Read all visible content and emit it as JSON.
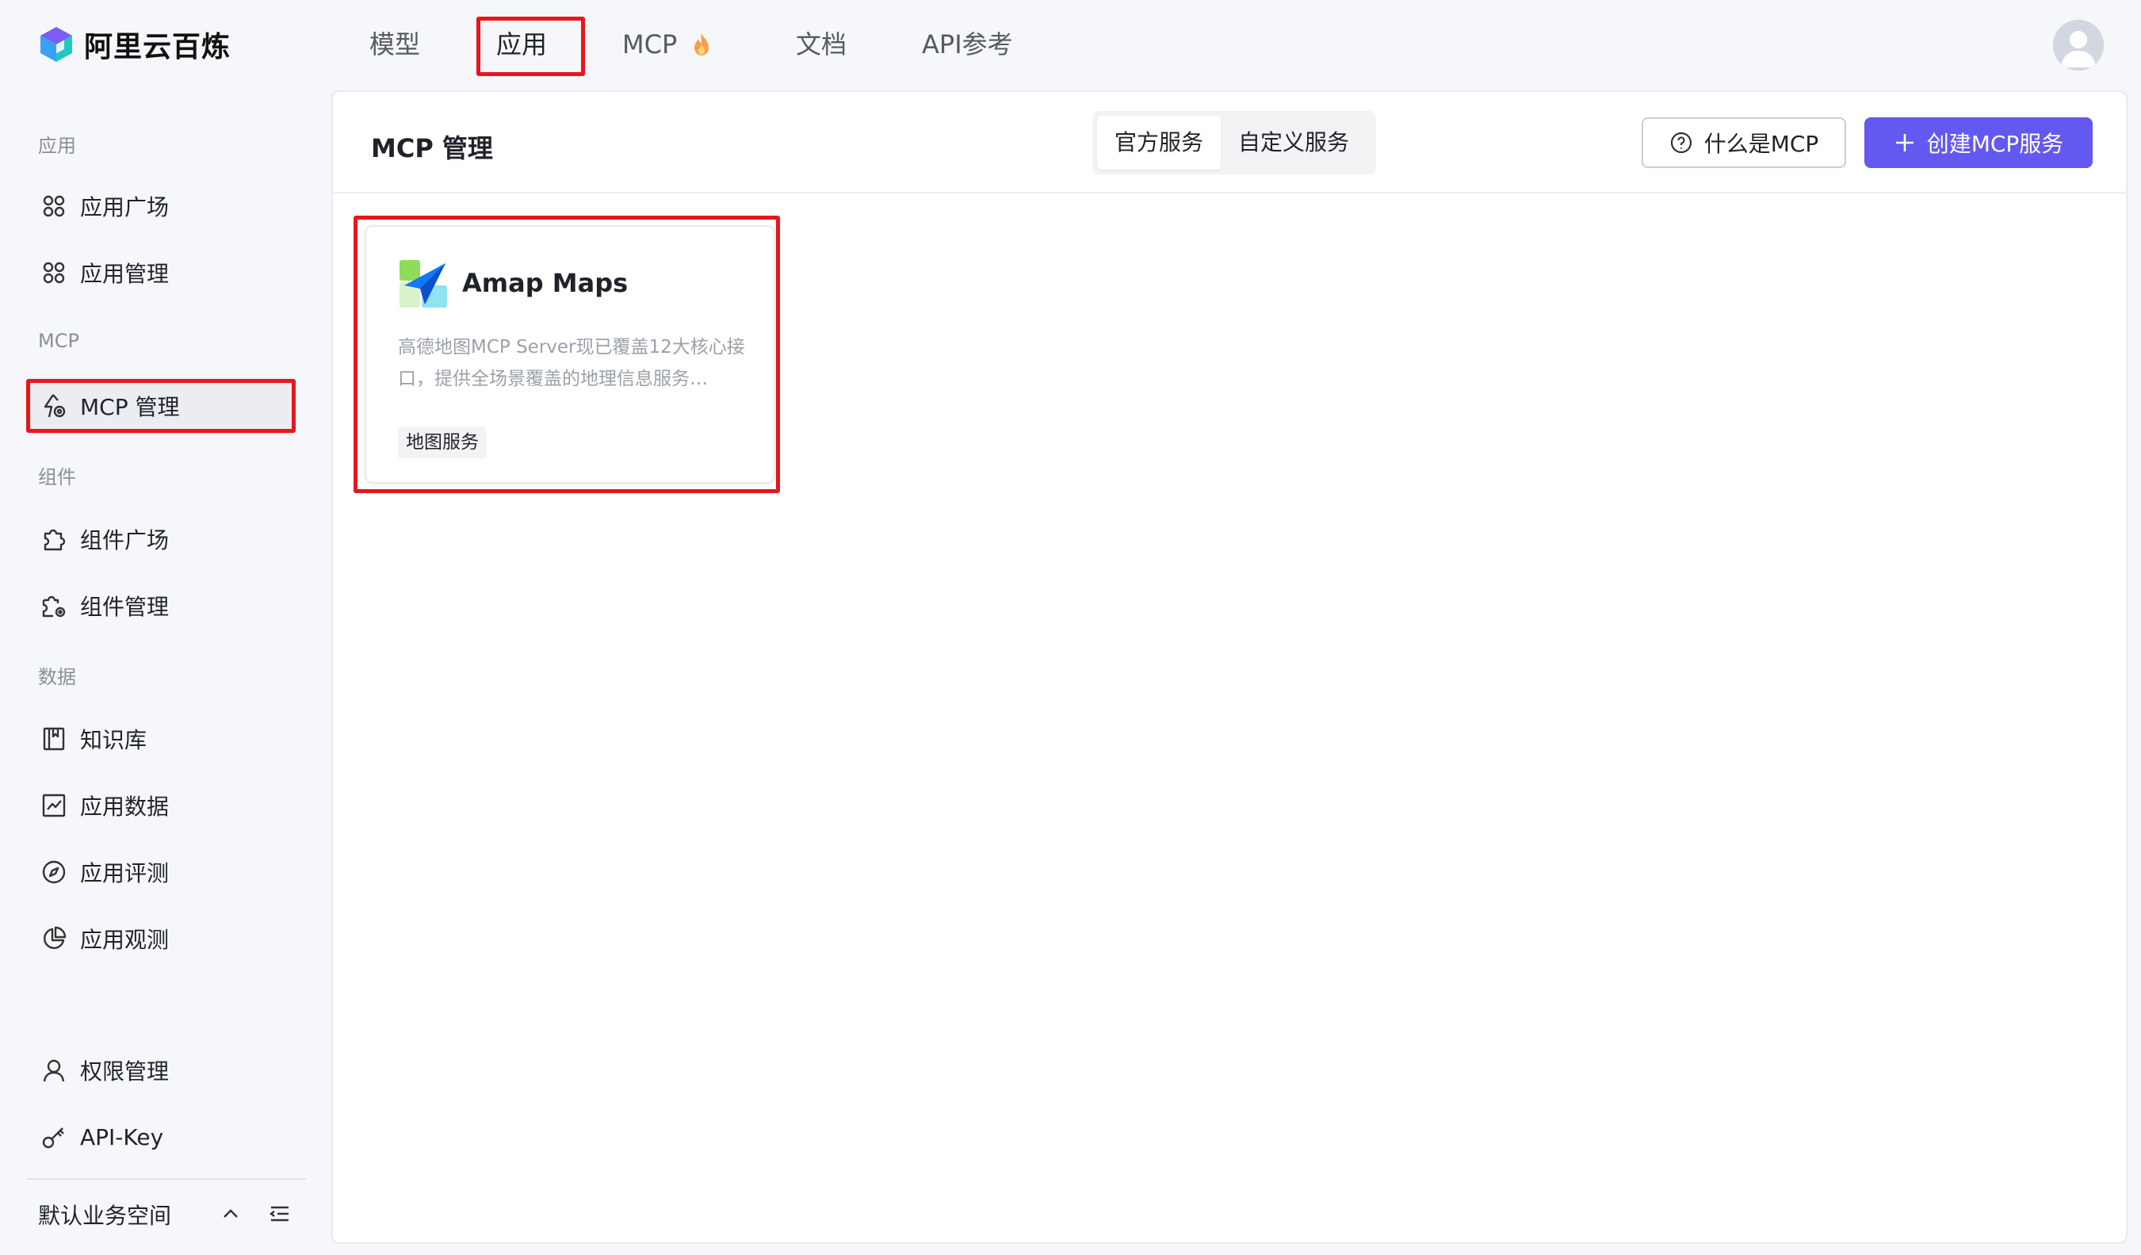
{
  "brand": {
    "name": "阿里云百炼",
    "logo_icon": "bailian-cube-logo"
  },
  "topnav": {
    "items": [
      {
        "label": "模型"
      },
      {
        "label": "应用"
      },
      {
        "label": "MCP"
      },
      {
        "label": "文档"
      },
      {
        "label": "API参考"
      }
    ],
    "active_index": 1,
    "mcp_badge_icon": "flame-icon"
  },
  "sidebar": {
    "groups": {
      "app": "应用",
      "mcp": "MCP",
      "component": "组件",
      "data": "数据"
    },
    "items": [
      {
        "label": "应用广场",
        "icon": "grid-icon"
      },
      {
        "label": "应用管理",
        "icon": "grid-icon"
      },
      {
        "label": "MCP 管理",
        "icon": "mcp-icon"
      },
      {
        "label": "组件广场",
        "icon": "puzzle-icon"
      },
      {
        "label": "组件管理",
        "icon": "puzzle-gear-icon"
      },
      {
        "label": "知识库",
        "icon": "book-icon"
      },
      {
        "label": "应用数据",
        "icon": "chart-icon"
      },
      {
        "label": "应用评测",
        "icon": "compass-icon"
      },
      {
        "label": "应用观测",
        "icon": "pie-icon"
      },
      {
        "label": "权限管理",
        "icon": "user-icon"
      },
      {
        "label": "API-Key",
        "icon": "key-icon"
      }
    ],
    "active_index": 2,
    "workspace": "默认业务空间"
  },
  "main": {
    "title": "MCP 管理",
    "segments": [
      "官方服务",
      "自定义服务"
    ],
    "selected_segment": 0,
    "what_is_label": "什么是MCP",
    "create_label": "创建MCP服务"
  },
  "cards": [
    {
      "title": "Amap Maps",
      "description": "高德地图MCP Server现已覆盖12大核心接口，提供全场景覆盖的地理信息服务…",
      "tag": "地图服务",
      "icon": "amap-logo"
    }
  ],
  "colors": {
    "primary": "#6359f0",
    "highlight": "#e8151c",
    "flame": "#f08a24"
  }
}
